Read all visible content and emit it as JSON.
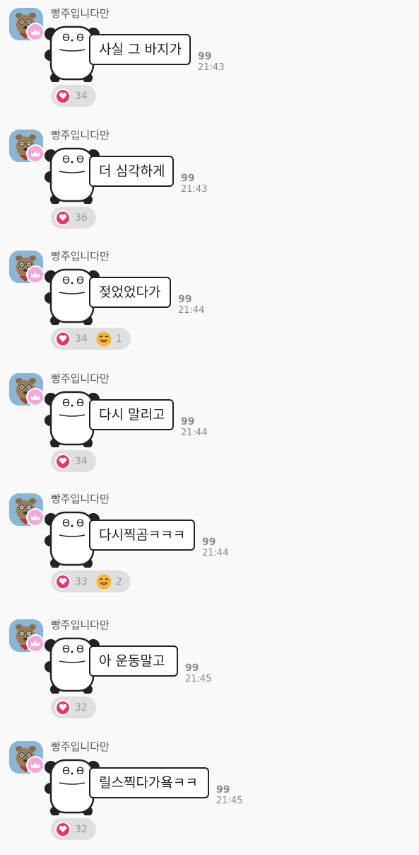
{
  "messages": [
    {
      "sender": "빵주입니다만",
      "text": "사실 그 바지가",
      "read_count": "99",
      "time": "21:43",
      "likes": "34",
      "laugh": null
    },
    {
      "sender": "빵주입니다만",
      "text": "더 심각하게",
      "read_count": "99",
      "time": "21:43",
      "likes": "36",
      "laugh": null
    },
    {
      "sender": "빵주입니다만",
      "text": "젖었었다가",
      "read_count": "99",
      "time": "21:44",
      "likes": "34",
      "laugh": "1"
    },
    {
      "sender": "빵주입니다만",
      "text": "다시 말리고",
      "read_count": "99",
      "time": "21:44",
      "likes": "34",
      "laugh": null
    },
    {
      "sender": "빵주입니다만",
      "text": "다시찍곰ㅋㅋㅋ",
      "read_count": "99",
      "time": "21:44",
      "likes": "33",
      "laugh": "2"
    },
    {
      "sender": "빵주입니다만",
      "text": "아 운동말고",
      "read_count": "99",
      "time": "21:45",
      "likes": "32",
      "laugh": null
    },
    {
      "sender": "빵주입니다만",
      "text": "릴스찍다가욬ㅋㅋ",
      "read_count": "99",
      "time": "21:45",
      "likes": "32",
      "laugh": null
    }
  ],
  "icons": {
    "avatar": "brown-bear-avatar-icon",
    "host_badge": "crown-icon",
    "sticker": "panda-sticker-icon",
    "like": "heart-icon",
    "laugh": "laughing-emoji-icon"
  },
  "colors": {
    "background": "#f9f9f9",
    "heart": "#e7356b",
    "crown_badge": "#f5a8d8",
    "avatar_bg": "#8ab6d6"
  }
}
